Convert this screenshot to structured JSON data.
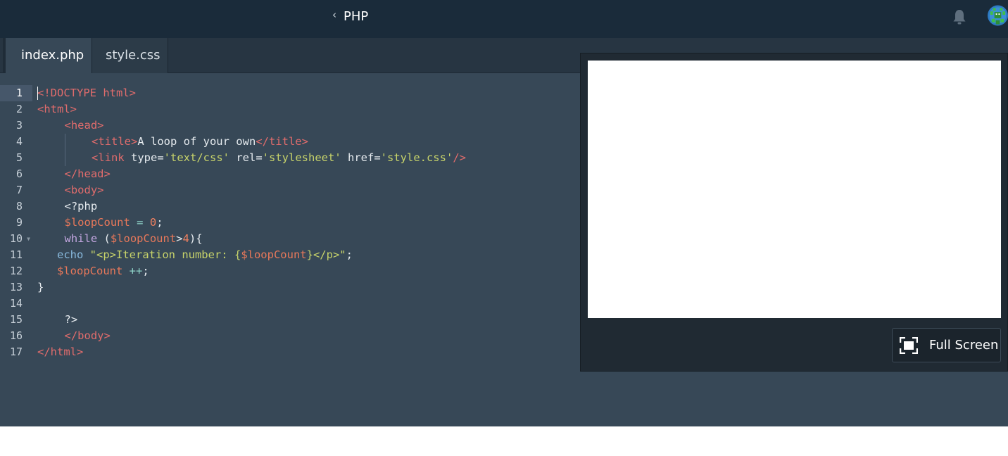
{
  "header": {
    "back_glyph": "‹",
    "title": "PHP",
    "icons": {
      "bell": "bell-icon",
      "avatar": "user-avatar"
    }
  },
  "tabs": [
    {
      "label": "index.php",
      "active": true
    },
    {
      "label": "style.css",
      "active": false
    }
  ],
  "editor": {
    "line_numbers": [
      "1",
      "2",
      "3",
      "4",
      "5",
      "6",
      "7",
      "8",
      "9",
      "10",
      "11",
      "12",
      "13",
      "14",
      "15",
      "16",
      "17"
    ],
    "current_line": "1",
    "lines": [
      {
        "indent": 0,
        "tokens": [
          [
            "tg",
            "<!DOCTYPE html>"
          ]
        ]
      },
      {
        "indent": 0,
        "tokens": [
          [
            "tg",
            "<html>"
          ]
        ]
      },
      {
        "indent": 1,
        "tokens": [
          [
            "tg",
            "<head>"
          ]
        ]
      },
      {
        "indent": 2,
        "tokens": [
          [
            "tg",
            "<title>"
          ],
          [
            "pl",
            "A loop of your own"
          ],
          [
            "tg",
            "</title>"
          ]
        ]
      },
      {
        "indent": 2,
        "tokens": [
          [
            "tg",
            "<link "
          ],
          [
            "pl",
            "type="
          ],
          [
            "st",
            "'text/css'"
          ],
          [
            "pl",
            " rel="
          ],
          [
            "st",
            "'stylesheet'"
          ],
          [
            "pl",
            " href="
          ],
          [
            "st",
            "'style.css'"
          ],
          [
            "tg",
            "/>"
          ]
        ]
      },
      {
        "indent": 1,
        "tokens": [
          [
            "tg",
            "</head>"
          ]
        ]
      },
      {
        "indent": 1,
        "tokens": [
          [
            "tg",
            "<body>"
          ]
        ]
      },
      {
        "indent": 1,
        "tokens": [
          [
            "pl",
            "<?php"
          ]
        ]
      },
      {
        "indent": 1,
        "tokens": [
          [
            "vr",
            "$loopCount"
          ],
          [
            "pl",
            " "
          ],
          [
            "op",
            "="
          ],
          [
            "pl",
            " "
          ],
          [
            "nm",
            "0"
          ],
          [
            "pl",
            ";"
          ]
        ]
      },
      {
        "indent": 1,
        "tokens": [
          [
            "kw",
            "while"
          ],
          [
            "pl",
            " ("
          ],
          [
            "vr",
            "$loopCount"
          ],
          [
            "pl",
            ">"
          ],
          [
            "nm",
            "4"
          ],
          [
            "pl",
            "){"
          ]
        ]
      },
      {
        "indent": 0,
        "tokens": [
          [
            "pl",
            "   "
          ],
          [
            "ec",
            "echo"
          ],
          [
            "pl",
            " "
          ],
          [
            "st",
            "\"<p>Iteration number: {"
          ],
          [
            "vr",
            "$loopCount"
          ],
          [
            "st",
            "}</p>\""
          ],
          [
            "pl",
            ";"
          ]
        ]
      },
      {
        "indent": 0,
        "tokens": [
          [
            "pl",
            "   "
          ],
          [
            "vr",
            "$loopCount"
          ],
          [
            "pl",
            " "
          ],
          [
            "op",
            "++"
          ],
          [
            "pl",
            ";"
          ]
        ]
      },
      {
        "indent": 0,
        "tokens": [
          [
            "pl",
            "}"
          ]
        ]
      },
      {
        "indent": 0,
        "tokens": []
      },
      {
        "indent": 1,
        "tokens": [
          [
            "pl",
            "?>"
          ]
        ]
      },
      {
        "indent": 1,
        "tokens": [
          [
            "tg",
            "</body>"
          ]
        ]
      },
      {
        "indent": 0,
        "tokens": [
          [
            "tg",
            "</html>"
          ]
        ]
      }
    ]
  },
  "preview": {
    "fullscreen_label": "Full Screen",
    "fullscreen_icon": "fullscreen-icon"
  },
  "colors": {
    "topbar": "#1a2b3a",
    "editor_bg": "#374857",
    "tag": "#e06c6c",
    "string": "#c7d36a",
    "variable": "#e8785a"
  }
}
